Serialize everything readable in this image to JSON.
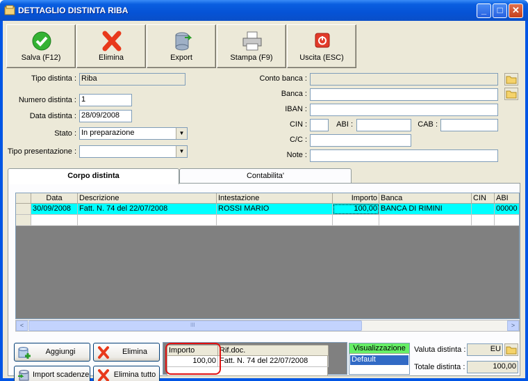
{
  "window": {
    "title": "DETTAGLIO DISTINTA RIBA",
    "controls": [
      "_",
      "□",
      "✕"
    ]
  },
  "toolbar": [
    {
      "label": "Salva (F12)",
      "icon": "check-icon"
    },
    {
      "label": "Elimina",
      "icon": "delete-x-icon"
    },
    {
      "label": "Export",
      "icon": "export-database-icon"
    },
    {
      "label": "Stampa (F9)",
      "icon": "printer-icon"
    },
    {
      "label": "Uscita (ESC)",
      "icon": "power-icon"
    }
  ],
  "form": {
    "tipo_distinta": {
      "label": "Tipo distinta :",
      "value": "Riba"
    },
    "numero_distinta": {
      "label": "Numero distinta :",
      "value": "1"
    },
    "data_distinta": {
      "label": "Data distinta :",
      "value": "28/09/2008"
    },
    "stato": {
      "label": "Stato :",
      "value": "In preparazione"
    },
    "tipo_presentazione": {
      "label": "Tipo presentazione :",
      "value": ""
    },
    "conto_banca": {
      "label": "Conto banca :",
      "value": ""
    },
    "banca": {
      "label": "Banca :",
      "value": ""
    },
    "iban": {
      "label": "IBAN :",
      "value": ""
    },
    "cin": {
      "label": "CIN :",
      "value": ""
    },
    "abi": {
      "label": "ABI :",
      "value": ""
    },
    "cab": {
      "label": "CAB :",
      "value": ""
    },
    "cc": {
      "label": "C/C :",
      "value": ""
    },
    "note": {
      "label": "Note :",
      "value": ""
    }
  },
  "tabs": [
    {
      "label": "Corpo distinta",
      "active": true
    },
    {
      "label": "Contabilita'",
      "active": false
    }
  ],
  "grid": {
    "columns": [
      "Data",
      "Descrizione",
      "Intestazione",
      "Importo",
      "Banca",
      "CIN",
      "ABI"
    ],
    "rows": [
      [
        "30/09/2008",
        "Fatt. N. 74 del 22/07/2008",
        "ROSSI MARIO",
        "100,00",
        "BANCA DI RIMINI",
        "",
        "00000"
      ]
    ],
    "scroll_left": "<",
    "scroll_right": ">",
    "scroll_grip": "III"
  },
  "actions": {
    "aggiungi": "Aggiungi",
    "elimina": "Elimina",
    "import_scadenze": "Import scadenze",
    "elimina_tutto": "Elimina tutto"
  },
  "subgrid": {
    "columns": [
      "Importo",
      "Rif.doc."
    ],
    "rows": [
      [
        "100,00",
        "Fatt. N. 74 del 22/07/2008"
      ]
    ]
  },
  "visualizzazione": {
    "header": "Visualizzazione",
    "items": [
      "Default"
    ]
  },
  "totals": {
    "valuta_label": "Valuta distinta :",
    "valuta_value": "EU",
    "totale_label": "Totale distinta :",
    "totale_value": "100,00"
  },
  "colors": {
    "title_bar": "#0a5fe0",
    "row_selected": "#00ffff",
    "highlight": "#e01010",
    "vis_header": "#66ee66",
    "vis_selected": "#316ac5"
  }
}
